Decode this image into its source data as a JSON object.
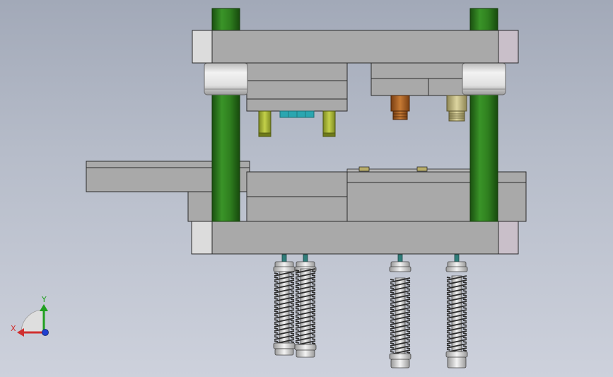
{
  "viewport": {
    "title": "",
    "background_top": "#a2a9b8",
    "background_bottom": "#cdd1dc"
  },
  "colors": {
    "plate_fill": "#a9a9a9",
    "plate_stroke": "#2a2a2a",
    "plate_end_left": "#dcdcdc",
    "plate_end_right": "#c9bfc9",
    "guide_post": "#2f7f1f",
    "guide_post_dark": "#1d5a12",
    "bushing": "#d8d8d8",
    "pilot_pin": "#a8b83c",
    "punch_cyan": "#2aa6b0",
    "punch_orange": "#b56a2a",
    "punch_beige": "#c8c08a",
    "spring_coil": "#2b2b2b",
    "spring_core": "#e6e6e6",
    "bolt_teal": "#2f7d7a"
  },
  "triad": {
    "x_label": "X",
    "y_label": "Y",
    "x_color": "#d03030",
    "y_color": "#20a020",
    "z_color": "#2040d0"
  }
}
